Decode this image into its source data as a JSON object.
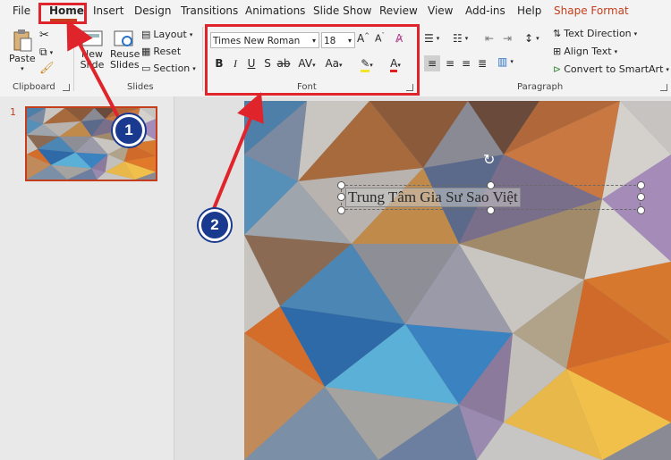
{
  "menu": {
    "tabs": [
      "File",
      "Home",
      "Insert",
      "Design",
      "Transitions",
      "Animations",
      "Slide Show",
      "Review",
      "View",
      "Add-ins",
      "Help",
      "Shape Format"
    ],
    "active_tab": "Home",
    "contextual_color": "#c43e1c"
  },
  "clipboard": {
    "paste_label": "Paste",
    "group_label": "Clipboard"
  },
  "slides": {
    "new_slide_label": "New Slide",
    "reuse_label": "Reuse Slides",
    "layout_label": "Layout",
    "reset_label": "Reset",
    "section_label": "Section",
    "group_label": "Slides"
  },
  "font": {
    "font_name": "Times New Roman",
    "font_size": "18",
    "group_label": "Font"
  },
  "paragraph": {
    "text_direction_label": "Text Direction",
    "align_text_label": "Align Text",
    "smartart_label": "Convert to SmartArt",
    "group_label": "Paragraph"
  },
  "thumbnails": [
    {
      "number": "1"
    }
  ],
  "slide": {
    "textbox_text": "Trung Tâm Gia Sư Sao Việt"
  },
  "annotations": {
    "badge_1": "1",
    "badge_2": "2",
    "highlight_color": "#e0242b",
    "badge_color": "#1a3a8f"
  }
}
